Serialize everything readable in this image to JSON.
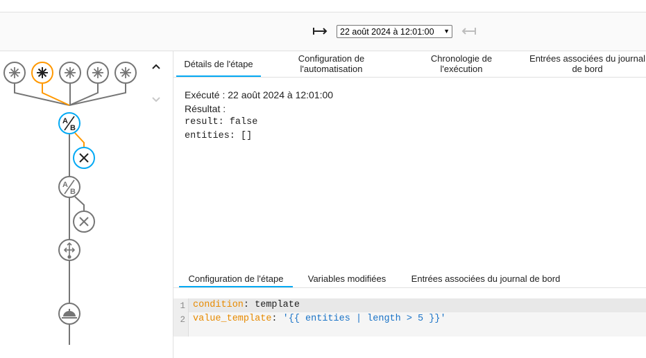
{
  "toolbar": {
    "prev_icon": "arrow-left-bar",
    "next_icon": "arrow-right-bar",
    "run_selector": "22 août 2024 à 12:01:00"
  },
  "tabs": [
    {
      "label": "Détails de l'étape",
      "active": true
    },
    {
      "label": "Configuration de l'automatisation",
      "active": false
    },
    {
      "label": "Chronologie de l'exécution",
      "active": false
    },
    {
      "label": "Entrées associées du journal de bord",
      "active": false
    }
  ],
  "details": {
    "executed": "Exécuté : 22 août 2024 à 12:01:00",
    "result_label": "Résultat :",
    "result_line": "result: false",
    "entities_line": "entities: []"
  },
  "subtabs": [
    {
      "label": "Configuration de l'étape",
      "active": true
    },
    {
      "label": "Variables modifiées",
      "active": false
    },
    {
      "label": "Entrées associées du journal de bord",
      "active": false
    }
  ],
  "code": {
    "line_numbers": [
      "1",
      "2"
    ],
    "line1": {
      "key": "condition",
      "sep": ": ",
      "value": "template"
    },
    "line2": {
      "key": "value_template",
      "sep": ": ",
      "value": "'{{ entities | length > 5 }}'"
    }
  },
  "graph": {
    "active_color": "#ff9800",
    "selected_color": "#03a9f4",
    "inactive_color": "#757575",
    "trigger_icons": [
      "asterisk-icon",
      "asterisk-icon",
      "asterisk-icon",
      "asterisk-icon",
      "asterisk-icon"
    ],
    "condition_icon": "ab-test-icon",
    "stop_icon": "close-icon",
    "choose_icon": "call-split-icon",
    "service_icon": "room-service-icon"
  }
}
